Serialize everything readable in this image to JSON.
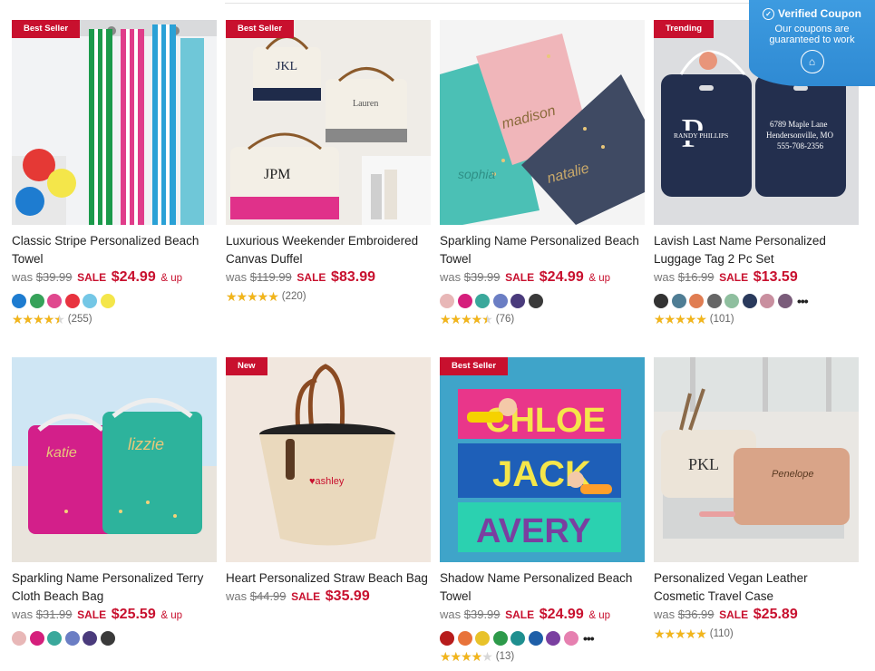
{
  "coupon": {
    "title": "Verified Coupon",
    "subtitle": "Our coupons are guaranteed to work"
  },
  "products": [
    {
      "badge": "Best Seller",
      "title": "Classic Stripe Personalized Beach Towel",
      "was_label": "was",
      "was": "$39.99",
      "sale_label": "SALE",
      "price": "$24.99",
      "up": "& up",
      "swatches": [
        "#1e7cd0",
        "#36a25a",
        "#e0488e",
        "#e8333f",
        "#74c7e6",
        "#f4e64a"
      ],
      "more": false,
      "rating": 4.5,
      "reviews": "(255)"
    },
    {
      "badge": "Best Seller",
      "title": "Luxurious Weekender Embroidered Canvas Duffel",
      "was_label": "was",
      "was": "$119.99",
      "sale_label": "SALE",
      "price": "$83.99",
      "up": "",
      "swatches": [],
      "more": false,
      "rating": 5,
      "reviews": "(220)"
    },
    {
      "badge": "",
      "title": "Sparkling Name Personalized Beach Towel",
      "was_label": "was",
      "was": "$39.99",
      "sale_label": "SALE",
      "price": "$24.99",
      "up": "& up",
      "swatches": [
        "#e8b7b7",
        "#d51f7c",
        "#3aa89b",
        "#6b7ec4",
        "#4a3b7c",
        "#3a3a3a"
      ],
      "more": false,
      "rating": 4.5,
      "reviews": "(76)"
    },
    {
      "badge": "Trending",
      "title": "Lavish Last Name Personalized Luggage Tag 2 Pc Set",
      "was_label": "was",
      "was": "$16.99",
      "sale_label": "SALE",
      "price": "$13.59",
      "up": "",
      "swatches": [
        "#333333",
        "#4f7d94",
        "#e07d52",
        "#666666",
        "#8fbf9f",
        "#2a3a5c",
        "#c98f9f",
        "#7a5c7a"
      ],
      "more": true,
      "rating": 5,
      "reviews": "(101)"
    },
    {
      "badge": "",
      "title": "Sparkling Name Personalized Terry Cloth Beach Bag",
      "was_label": "was",
      "was": "$31.99",
      "sale_label": "SALE",
      "price": "$25.59",
      "up": "& up",
      "swatches": [
        "#e8b7b7",
        "#d51f7c",
        "#3aa89b",
        "#6b7ec4",
        "#4a3b7c",
        "#3a3a3a"
      ],
      "more": false,
      "rating": null,
      "reviews": ""
    },
    {
      "badge": "New",
      "title": "Heart Personalized Straw Beach Bag",
      "was_label": "was",
      "was": "$44.99",
      "sale_label": "SALE",
      "price": "$35.99",
      "up": "",
      "swatches": [],
      "more": false,
      "rating": null,
      "reviews": ""
    },
    {
      "badge": "Best Seller",
      "title": "Shadow Name Personalized Beach Towel",
      "was_label": "was",
      "was": "$39.99",
      "sale_label": "SALE",
      "price": "$24.99",
      "up": "& up",
      "swatches": [
        "#b71c1c",
        "#e8733a",
        "#e8c22a",
        "#2d9a4a",
        "#1f8f8f",
        "#1e5fa8",
        "#7a3fa0",
        "#e680b0"
      ],
      "more": true,
      "rating": 4,
      "reviews": "(13)"
    },
    {
      "badge": "",
      "title": "Personalized Vegan Leather Cosmetic Travel Case",
      "was_label": "was",
      "was": "$36.99",
      "sale_label": "SALE",
      "price": "$25.89",
      "up": "",
      "swatches": [],
      "more": false,
      "rating": 5,
      "reviews": "(110)"
    }
  ]
}
